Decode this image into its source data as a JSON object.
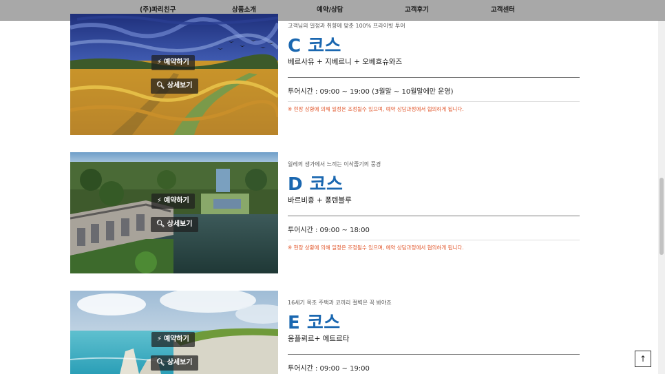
{
  "nav": {
    "items": [
      {
        "label": "(주)파리친구"
      },
      {
        "label": "상품소개"
      },
      {
        "label": "예약/상담"
      },
      {
        "label": "고객후기"
      },
      {
        "label": "고객센터"
      }
    ]
  },
  "courses": [
    {
      "tagline": "고객님의 일정과 취향에 맞춘 100% 프라이빗 투어",
      "title": "C 코스",
      "route": "베르사유 + 지베르니 + 오베흐슈와즈",
      "hours": "투어시간 : 09:00 ~ 19:00 (3월말 ~ 10월말에만 운영)",
      "notice": "※ 현장 상황에 의해 일정은 조정될수 있으며, 예약 상담과정에서 협의하게 됩니다.",
      "reserve_label": "예약하기",
      "detail_label": "상세보기"
    },
    {
      "tagline": "일레의 생가에서 느끼는 이삭줍기의 풍경",
      "title": "D 코스",
      "route": "바르비죵 + 퐁텐블루",
      "hours": "투어시간 : 09:00 ~ 18:00",
      "notice": "※ 현장 상황에 의해 일정은 조정될수 있으며, 예약 상담과정에서 협의하게 됩니다.",
      "reserve_label": "예약하기",
      "detail_label": "상세보기"
    },
    {
      "tagline": "16세기 목조 주택과 코끼리 절벽은 꼭 봐야죠",
      "title": "E 코스",
      "route": "옹플뢰르+ 에트르타",
      "hours": "투어시간 : 09:00 ~ 19:00",
      "reserve_label": "예약하기",
      "detail_label": "상세보기"
    }
  ],
  "icons": {
    "reserve": "lightning-icon",
    "detail": "search-icon",
    "totop": "arrow-up-icon"
  },
  "colors": {
    "title": "#1a67b0",
    "notice": "#e2572c",
    "nav_bg": "#a8a8a8"
  }
}
